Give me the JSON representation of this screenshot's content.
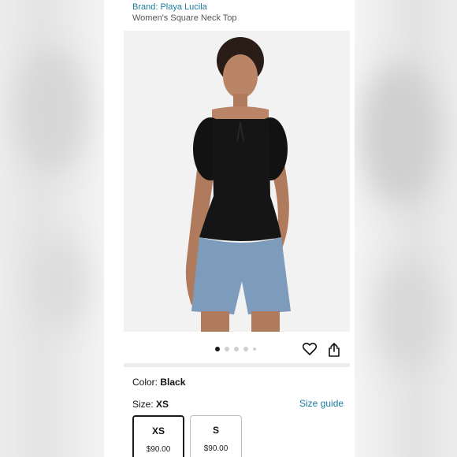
{
  "product": {
    "brand": "Brand: Playa Lucila",
    "title": "Women's Square Neck Top"
  },
  "gallery": {
    "image_count": 5,
    "active_index": 0
  },
  "actions": {
    "favorite_icon": "heart-icon",
    "share_icon": "share-icon"
  },
  "color": {
    "label": "Color:",
    "value": "Black"
  },
  "size": {
    "label": "Size:",
    "value": "XS",
    "guide_link": "Size guide",
    "options": [
      {
        "size": "XS",
        "price": "$90.00",
        "selected": true
      },
      {
        "size": "S",
        "price": "$90.00",
        "selected": false
      }
    ]
  },
  "colors": {
    "link": "#1a7a9c",
    "text": "#111111"
  }
}
